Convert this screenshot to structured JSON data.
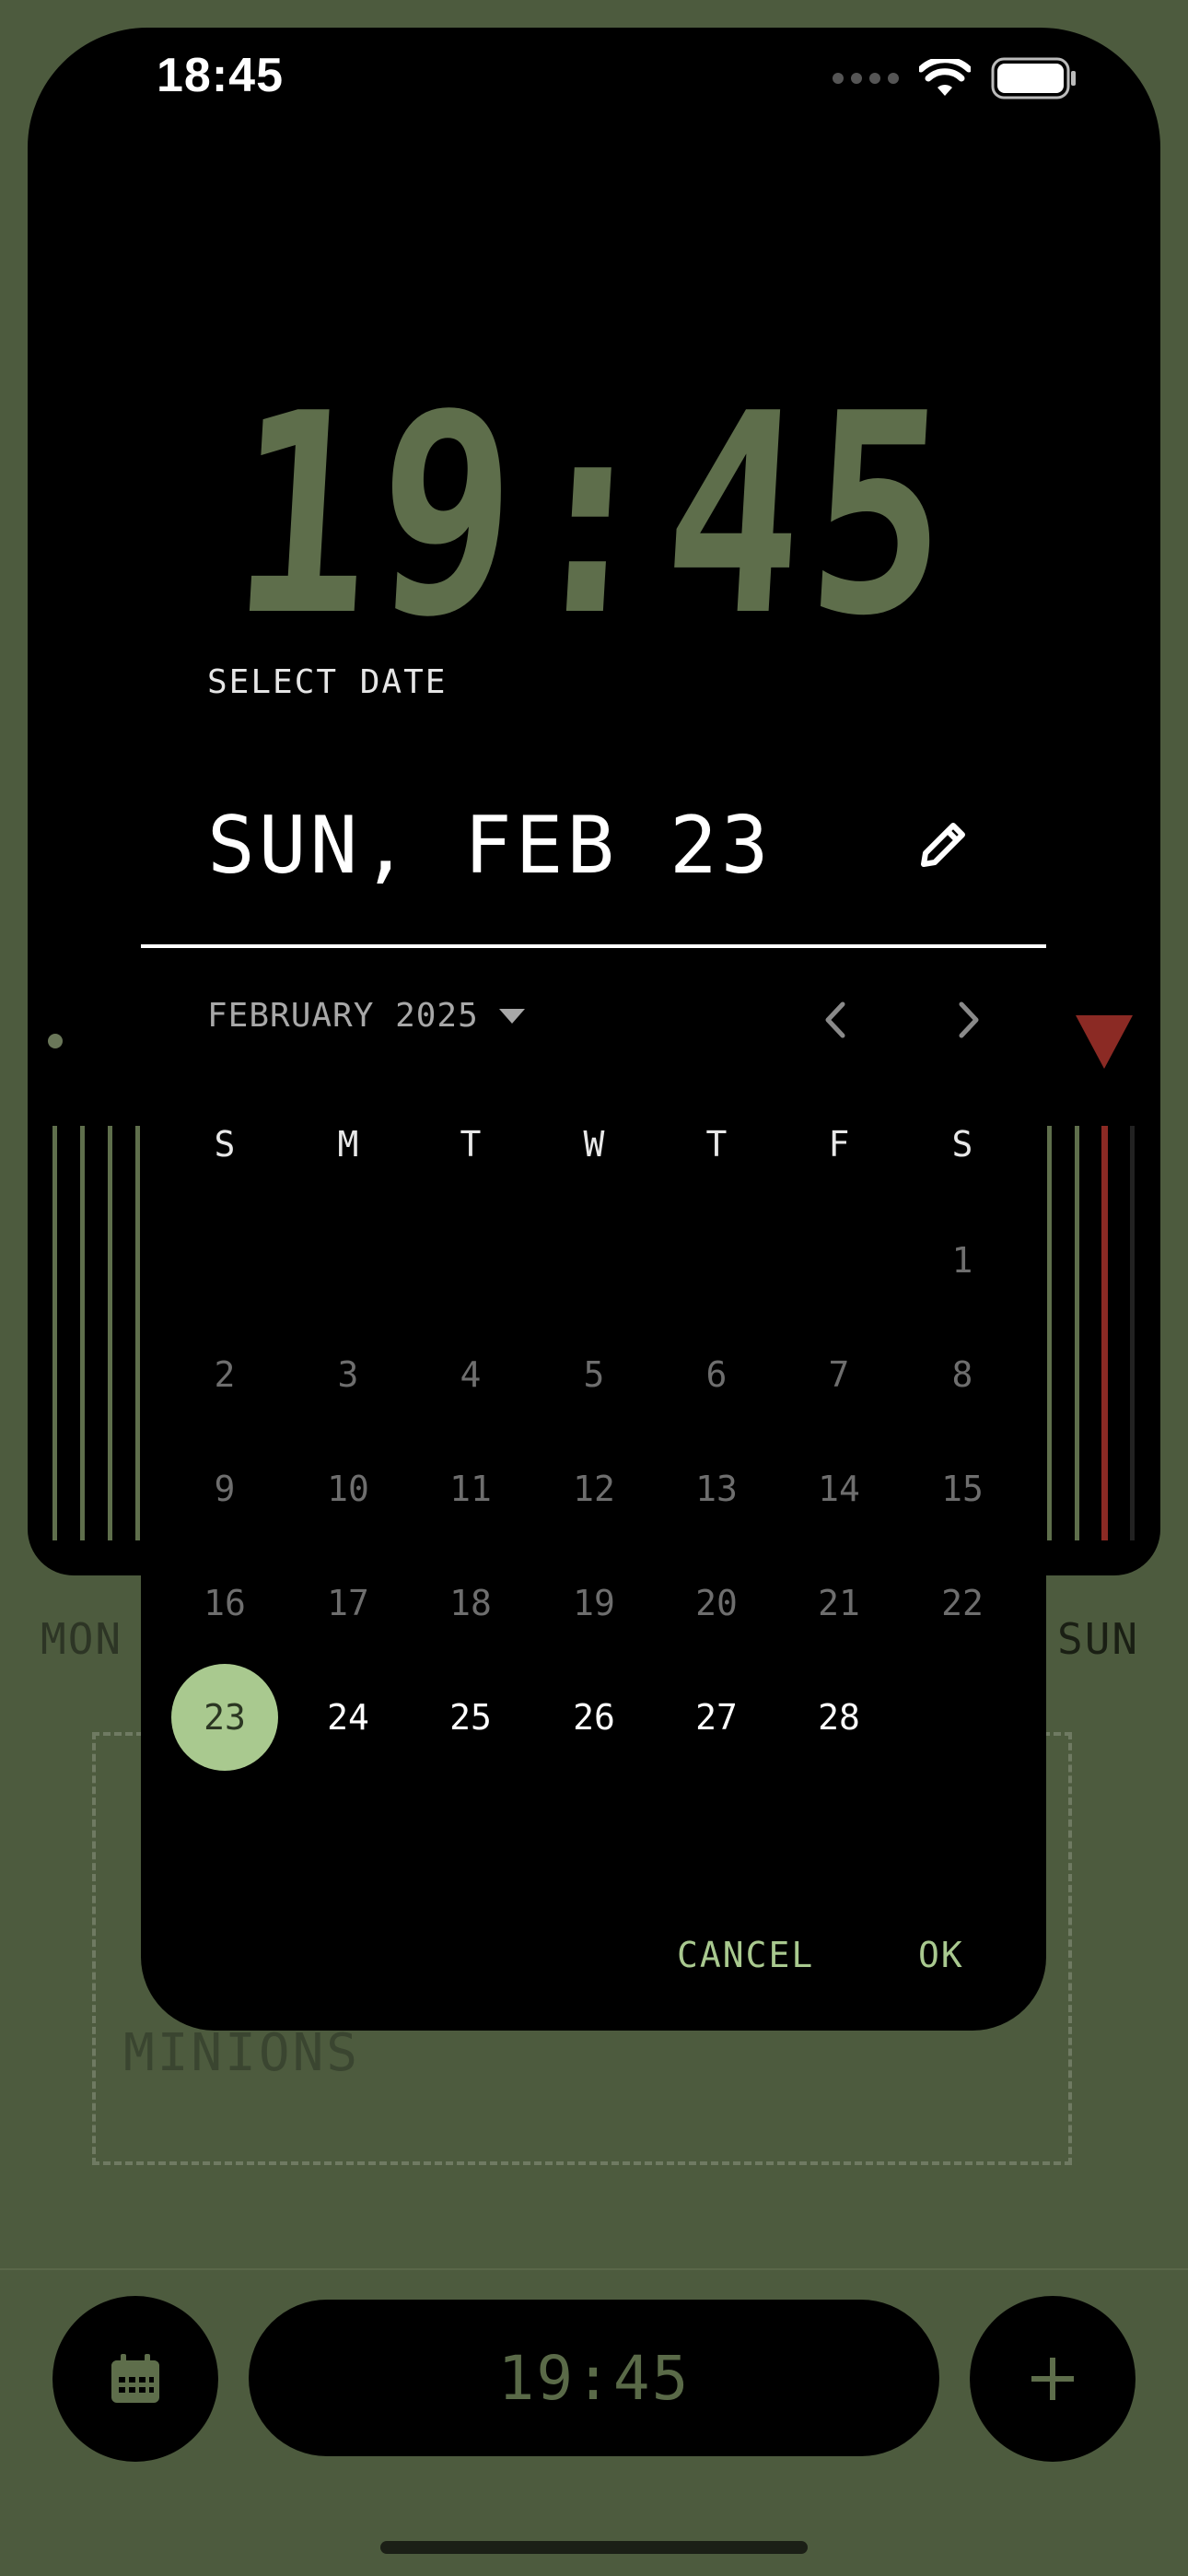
{
  "status_bar": {
    "time": "18:45"
  },
  "background": {
    "clock": "19:45",
    "day_left": "MON",
    "day_right": "SUN",
    "list_label": "MINIONS",
    "nav_time": "19:45",
    "colors": {
      "background": "#4d5b3e",
      "accent_red": "#8b2a24",
      "digit_green": "#5e6e4b"
    }
  },
  "date_picker": {
    "label": "SELECT DATE",
    "selected_display": "SUN, FEB 23",
    "month_label": "FEBRUARY 2025",
    "weekdays": [
      "S",
      "M",
      "T",
      "W",
      "T",
      "F",
      "S"
    ],
    "days": [
      "1",
      "2",
      "3",
      "4",
      "5",
      "6",
      "7",
      "8",
      "9",
      "10",
      "11",
      "12",
      "13",
      "14",
      "15",
      "16",
      "17",
      "18",
      "19",
      "20",
      "21",
      "22",
      "23",
      "24",
      "25",
      "26",
      "27",
      "28"
    ],
    "selected_day": "23",
    "cancel_label": "CANCEL",
    "ok_label": "OK",
    "colors": {
      "selected_fill": "#a9c98f",
      "action_text": "#a9c98f"
    },
    "icons": {
      "edit": "pencil-icon",
      "prev": "chevron-left-icon",
      "next": "chevron-right-icon",
      "dropdown": "caret-down-icon"
    }
  },
  "nav": {
    "icons": {
      "calendar": "calendar-icon",
      "add": "plus-icon"
    }
  }
}
